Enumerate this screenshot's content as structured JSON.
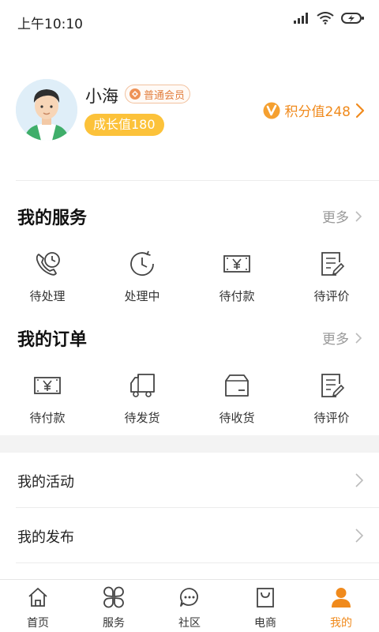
{
  "status_bar": {
    "time": "上午10:10"
  },
  "profile": {
    "name": "小海",
    "member_level": "普通会员",
    "growth_label": "成长值180",
    "points_label": "积分值248"
  },
  "services": {
    "title": "我的服务",
    "more": "更多",
    "items": [
      {
        "label": "待处理",
        "icon": "phone-clock-icon"
      },
      {
        "label": "处理中",
        "icon": "clock-icon"
      },
      {
        "label": "待付款",
        "icon": "yen-bill-icon"
      },
      {
        "label": "待评价",
        "icon": "edit-note-icon"
      }
    ]
  },
  "orders": {
    "title": "我的订单",
    "more": "更多",
    "items": [
      {
        "label": "待付款",
        "icon": "yen-bill-icon"
      },
      {
        "label": "待发货",
        "icon": "truck-icon"
      },
      {
        "label": "待收货",
        "icon": "box-icon"
      },
      {
        "label": "待评价",
        "icon": "edit-note-icon"
      }
    ]
  },
  "list": [
    {
      "label": "我的活动"
    },
    {
      "label": "我的发布"
    }
  ],
  "tabs": [
    {
      "label": "首页",
      "icon": "home-icon"
    },
    {
      "label": "服务",
      "icon": "grid-petal-icon"
    },
    {
      "label": "社区",
      "icon": "chat-icon"
    },
    {
      "label": "电商",
      "icon": "bag-icon"
    },
    {
      "label": "我的",
      "icon": "person-icon",
      "active": true
    }
  ],
  "colors": {
    "accent": "#f08a1c",
    "growth_badge": "#fcc23a",
    "member_text": "#e27f3f"
  }
}
